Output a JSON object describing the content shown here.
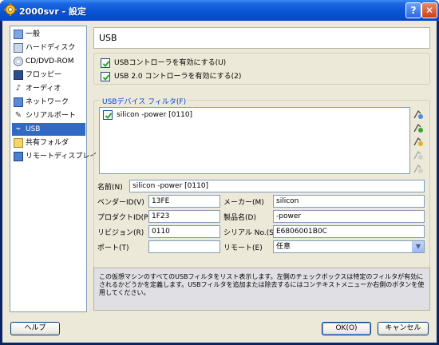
{
  "window": {
    "title": "2000svr - 設定",
    "help_glyph": "?",
    "close_glyph": "✕"
  },
  "sidebar": {
    "items": [
      {
        "label": "一般",
        "icon": "general-icon"
      },
      {
        "label": "ハードディスク",
        "icon": "harddisk-icon"
      },
      {
        "label": "CD/DVD-ROM",
        "icon": "cdrom-icon"
      },
      {
        "label": "フロッピー",
        "icon": "floppy-icon"
      },
      {
        "label": "オーディオ",
        "icon": "audio-icon"
      },
      {
        "label": "ネットワーク",
        "icon": "network-icon"
      },
      {
        "label": "シリアルポート",
        "icon": "serial-port-icon"
      },
      {
        "label": "USB",
        "icon": "usb-icon",
        "selected": true
      },
      {
        "label": "共有フォルダ",
        "icon": "shared-folder-icon"
      },
      {
        "label": "リモートディスプレイ",
        "icon": "remote-display-icon"
      }
    ]
  },
  "header": {
    "title": "USB"
  },
  "usb_options": {
    "enable_usb_label": "USBコントローラを有効にする(U)",
    "enable_usb_checked": true,
    "enable_usb2_label": "USB 2.0 コントローラを有効にする(2)",
    "enable_usb2_checked": true
  },
  "filters": {
    "group_label": "USBデバイス フィルタ(F)",
    "items": [
      {
        "label": "silicon -power [0110]",
        "checked": true
      }
    ],
    "tool_icons": [
      "add-filter-icon",
      "add-from-device-icon",
      "edit-filter-icon",
      "remove-filter-icon",
      "move-filter-icon"
    ]
  },
  "fields": {
    "name_label": "名前(N)",
    "name_value": "silicon -power [0110]",
    "vendor_id_label": "ベンダーID(V)",
    "vendor_id_value": "13FE",
    "manufacturer_label": "メーカー(M)",
    "manufacturer_value": "silicon",
    "product_id_label": "プロダクトID(P)",
    "product_id_value": "1F23",
    "product_label": "製品名(D)",
    "product_value": "-power",
    "revision_label": "リビジョン(R)",
    "revision_value": "0110",
    "serial_label": "シリアル No.(S)",
    "serial_value": "E6806001B0C",
    "port_label": "ポート(T)",
    "port_value": "",
    "remote_label": "リモート(E)",
    "remote_value": "任意"
  },
  "info": {
    "text": "この仮想マシンのすべてのUSBフィルタをリスト表示します。左側のチェックボックスは特定のフィルタが有効にされるかどうかを定義します。USBフィルタを追加または除去するにはコンテキストメニューか右側のボタンを使用してください。"
  },
  "buttons": {
    "help": "ヘルプ",
    "ok": "OK(O)",
    "cancel": "キャンセル"
  },
  "colors": {
    "titlebar": "#0a55d6",
    "selection": "#316ac5",
    "dialog_bg": "#ece9d8",
    "group_label": "#0046d5"
  }
}
